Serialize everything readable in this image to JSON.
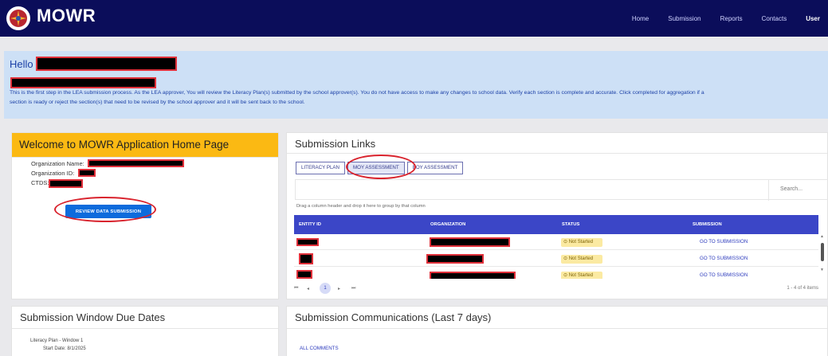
{
  "app": {
    "title": "MOWR",
    "brand_color": "#0b0d5a"
  },
  "nav": {
    "items": [
      "Home",
      "Submission",
      "Reports",
      "Contacts"
    ],
    "user_label": "User"
  },
  "hello": {
    "greeting": "Hello",
    "line1": "This is the first step in the LEA submission process. As the LEA approver, You will review the Literacy Plan(s) submitted by the school approver(s). You do not have access to make any changes to school data. Verify each section is complete and accurate. Click completed for aggregation if a",
    "line2": "section is ready or reject the section(s) that need to be revised by the school approver and it will be sent back to the school."
  },
  "welcome": {
    "title": "Welcome to MOWR Application Home Page",
    "org_name_label": "Organization Name:",
    "org_id_label": "Organization ID:",
    "ctds_label": "CTDS:",
    "review_button": "REVIEW DATA SUBMISSION",
    "header_color": "#fbb913"
  },
  "submission_links": {
    "title": "Submission Links",
    "tabs": [
      "LITERACY PLAN",
      "MOY ASSESSMENT",
      "EOY ASSESSMENT"
    ],
    "active_tab": "MOY ASSESSMENT",
    "search_placeholder": "Search...",
    "drag_hint": "Drag a column header and drop it here to group by that column",
    "columns": [
      "ENTITY ID",
      "ORGANIZATION",
      "STATUS",
      "SUBMISSION"
    ],
    "rows": [
      {
        "status": "Not Started",
        "action": "GO TO SUBMISSION"
      },
      {
        "status": "Not Started",
        "action": "GO TO SUBMISSION"
      },
      {
        "status": "Not Started",
        "action": "GO TO SUBMISSION"
      }
    ],
    "pager": {
      "current_page": "1",
      "summary": "1 - 4 of 4 items",
      "first": "⏮",
      "prev": "◂",
      "next": "▸",
      "last": "⏭"
    },
    "header_color": "#3b46c7"
  },
  "due_dates": {
    "title": "Submission Window Due Dates",
    "item_title": "Literacy Plan - Window 1",
    "item_start": "Start Date: 8/1/2025"
  },
  "communications": {
    "title": "Submission Communications (Last 7 days)",
    "link": "ALL COMMENTS"
  }
}
